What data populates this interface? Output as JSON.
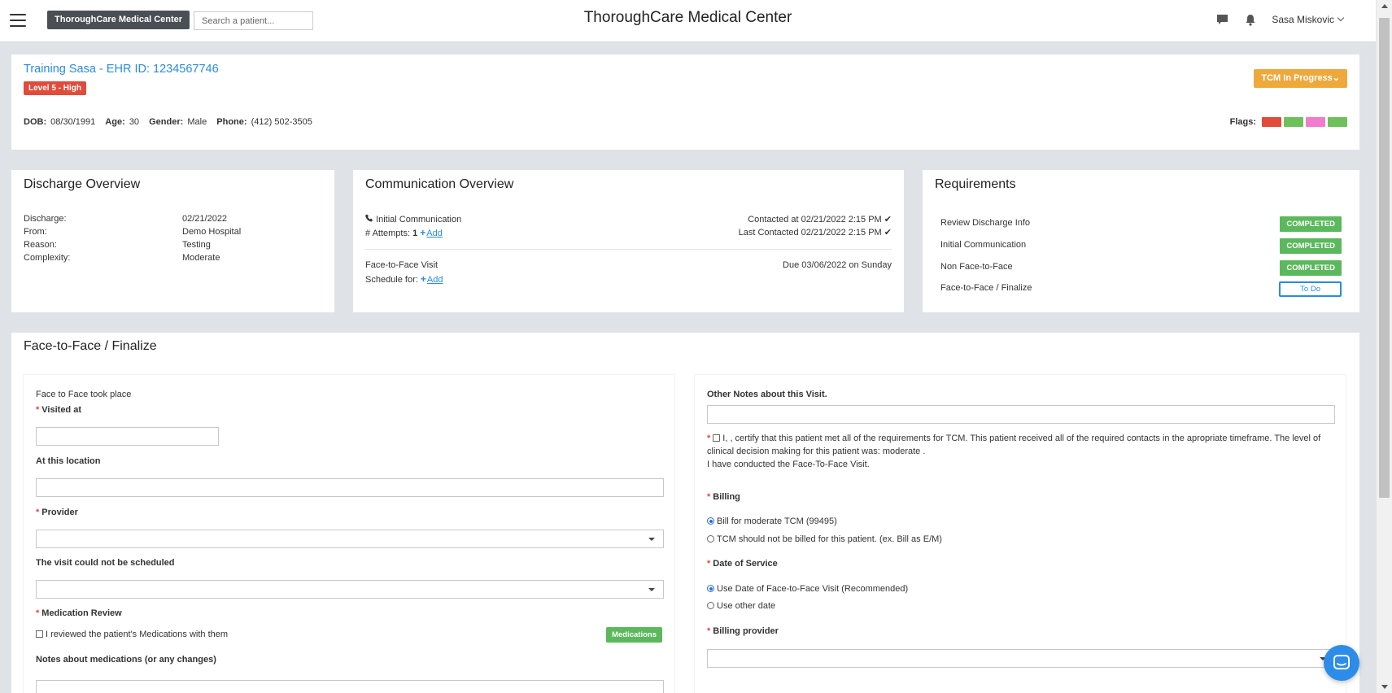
{
  "header": {
    "brand_button": "ThoroughCare Medical Center",
    "search_placeholder": "Search a patient...",
    "title": "ThoroughCare Medical Center",
    "user_name": "Sasa Miskovic"
  },
  "patient": {
    "name": "Training Sasa - EHR ID: 1234567746",
    "level": "Level 5 - High",
    "dob_label": "DOB:",
    "dob": "08/30/1991",
    "age_label": "Age:",
    "age": "30",
    "gender_label": "Gender:",
    "gender": "Male",
    "phone_label": "Phone:",
    "phone": "(412) 502-3505",
    "status_button": "TCM In Progress",
    "flags_label": "Flags:",
    "flag_colors": [
      "#e04b3b",
      "#6ec05a",
      "#f07ccb",
      "#6ec05a"
    ]
  },
  "discharge": {
    "title": "Discharge Overview",
    "rows": [
      {
        "label": "Discharge:",
        "value": "02/21/2022"
      },
      {
        "label": "From:",
        "value": "Demo Hospital"
      },
      {
        "label": "Reason:",
        "value": "Testing"
      },
      {
        "label": "Complexity:",
        "value": "Moderate"
      }
    ]
  },
  "communication": {
    "title": "Communication Overview",
    "initial_label": "Initial Communication",
    "attempts_label": "# Attempts:",
    "attempts_value": "1",
    "add_label": "Add",
    "contacted_at": "Contacted at 02/21/2022 2:15 PM",
    "last_contacted": "Last Contacted 02/21/2022 2:15 PM",
    "f2f_label": "Face-to-Face Visit",
    "schedule_label": "Schedule for:",
    "schedule_add": "Add",
    "due": "Due 03/06/2022 on Sunday"
  },
  "requirements": {
    "title": "Requirements",
    "items": [
      {
        "label": "Review Discharge Info",
        "status": "COMPLETED"
      },
      {
        "label": "Initial Communication",
        "status": "COMPLETED"
      },
      {
        "label": "Non Face-to-Face",
        "status": "COMPLETED"
      },
      {
        "label": "Face-to-Face / Finalize",
        "status": "To Do"
      }
    ]
  },
  "f2f": {
    "title": "Face-to-Face / Finalize",
    "took_place": "Face to Face took place",
    "visited_at_label": "Visited at",
    "location_label": "At this location",
    "provider_label": "Provider",
    "not_scheduled_label": "The visit could not be scheduled",
    "med_review_label": "Medication Review",
    "med_checkbox_label": "I reviewed the patient's Medications with them",
    "medications_button": "Medications",
    "med_notes_label": "Notes about medications (or any changes)",
    "other_notes_label": "Other Notes about this Visit.",
    "certify_text": "I, , certify that this patient met all of the requirements for TCM. This patient received all of the required contacts in the apropriate timeframe. The level of clinical decision making for this patient was: moderate .",
    "certify_text2": "I have conducted the Face-To-Face Visit.",
    "billing_label": "Billing",
    "billing_option1": "Bill for moderate TCM (99495)",
    "billing_option2": "TCM should not be billed for this patient. (ex. Bill as E/M)",
    "dos_label": "Date of Service",
    "dos_option1": "Use Date of Face-to-Face Visit (Recommended)",
    "dos_option2": "Use other date",
    "billing_provider_label": "Billing provider"
  }
}
